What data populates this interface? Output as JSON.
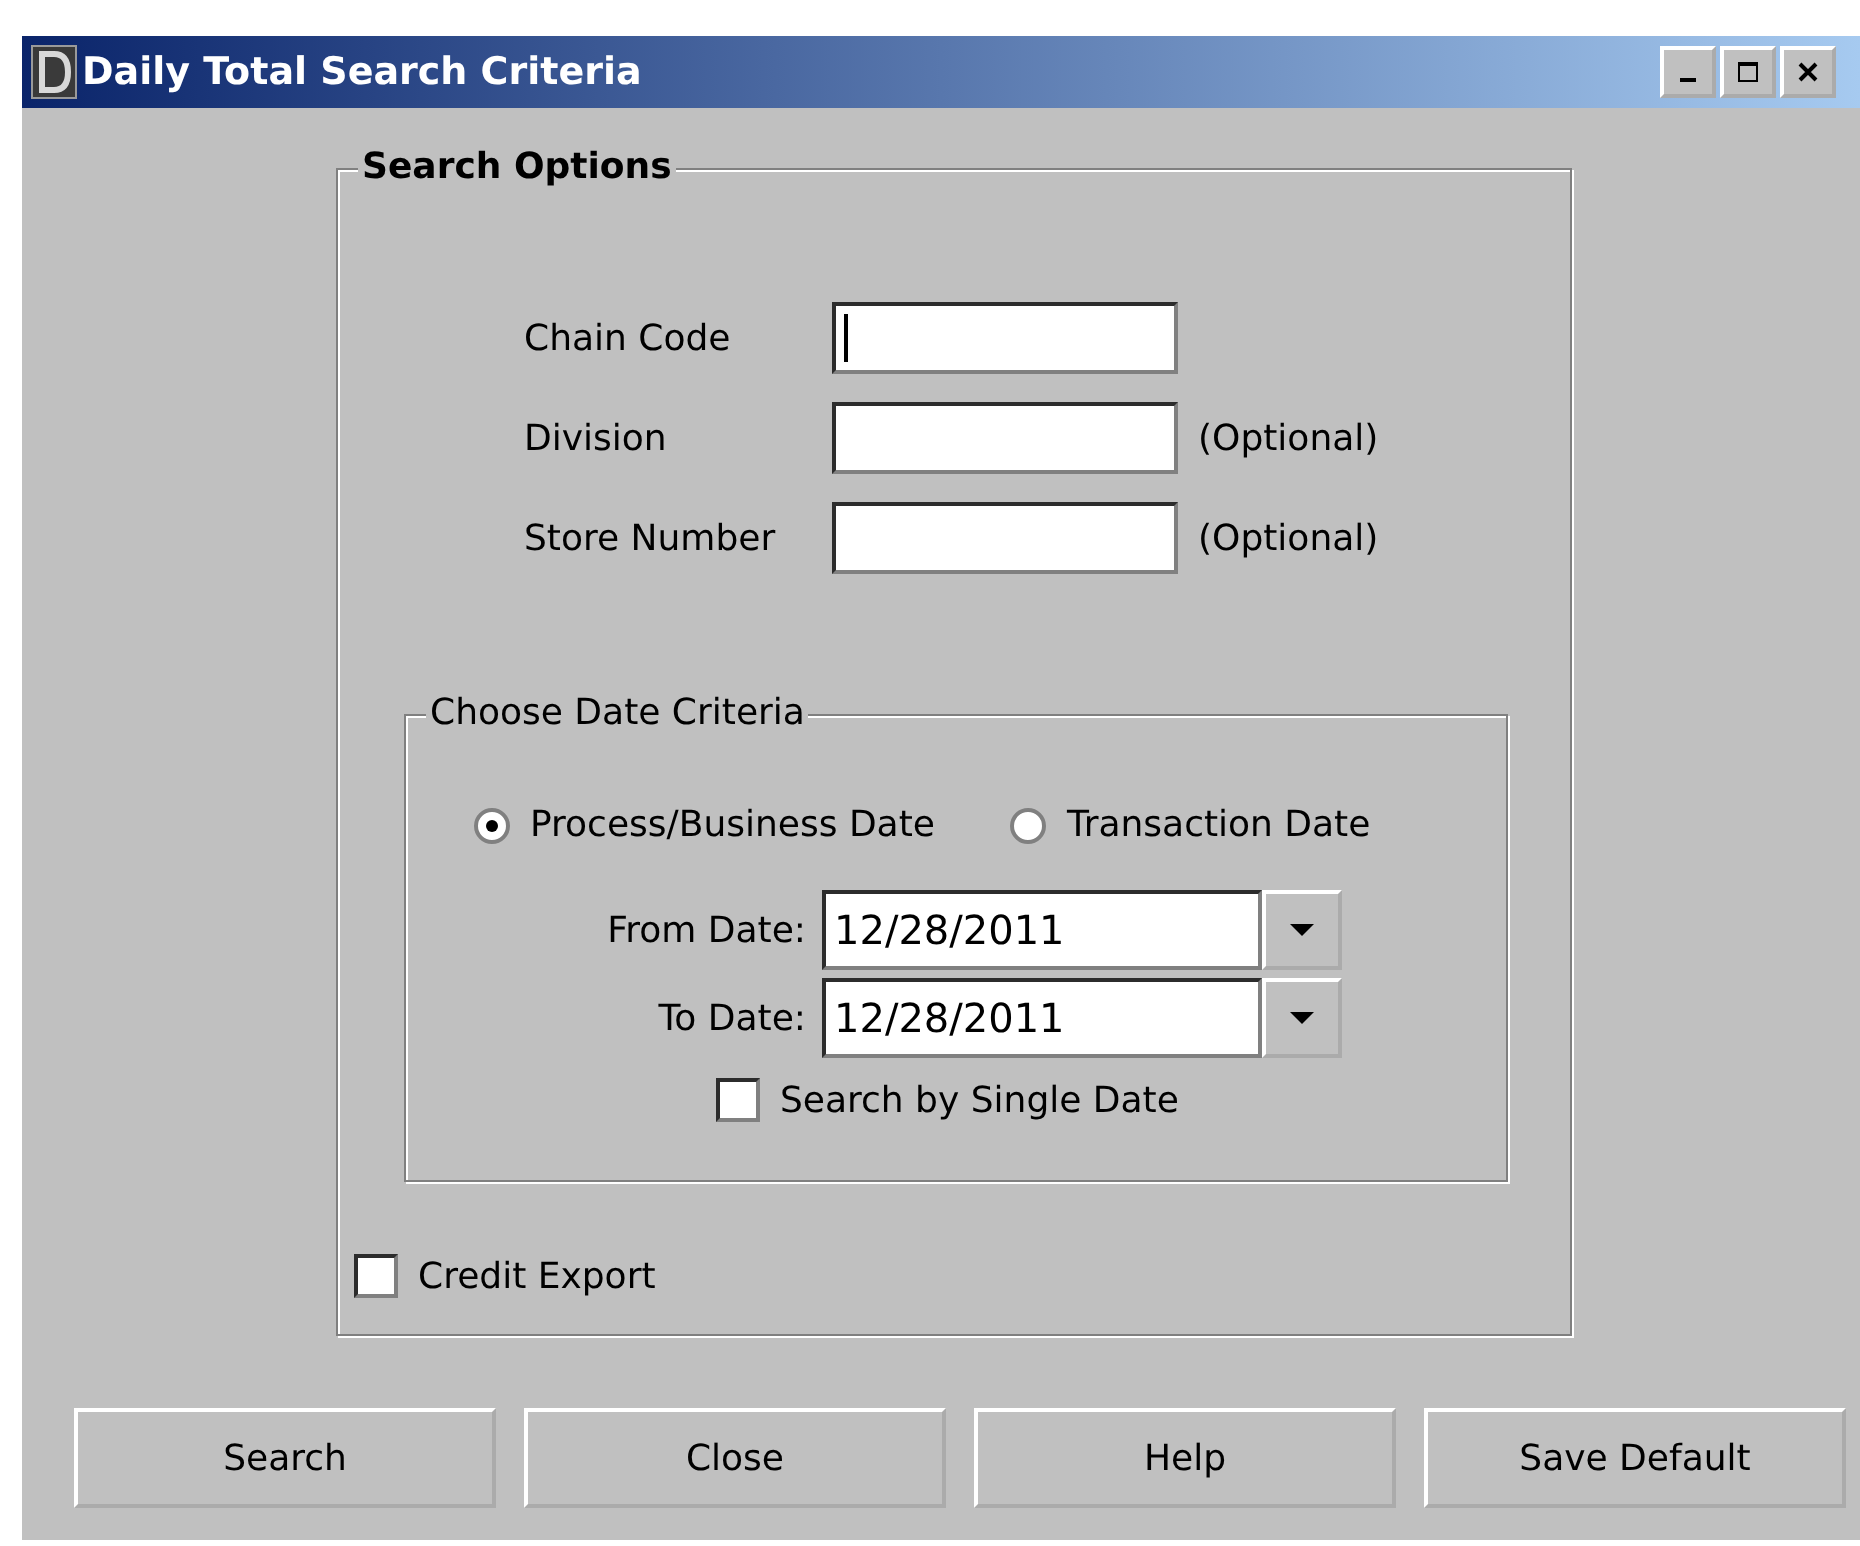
{
  "window": {
    "title": "Daily Total Search Criteria"
  },
  "search_options": {
    "title": "Search Options",
    "fields": [
      {
        "label": "Chain Code",
        "focused": true
      },
      {
        "label": "Division",
        "note": "(Optional)",
        "focused": false
      },
      {
        "label": "Store Number",
        "note": "(Optional)",
        "focused": false
      }
    ]
  },
  "date_criteria": {
    "title": "Choose Date Criteria",
    "radios": [
      {
        "label": "Process/Business Date",
        "selected": true
      },
      {
        "label": "Transaction Date",
        "selected": false
      }
    ],
    "dates": [
      {
        "label": "From Date:",
        "value": "12/28/2011"
      },
      {
        "label": "To Date:",
        "value": "12/28/2011"
      }
    ],
    "single_date": {
      "label": "Search by Single Date",
      "checked": false
    }
  },
  "credit_export": {
    "label": "Credit Export",
    "checked": false
  },
  "buttons": [
    "Search",
    "Close",
    "Help",
    "Save Default"
  ]
}
